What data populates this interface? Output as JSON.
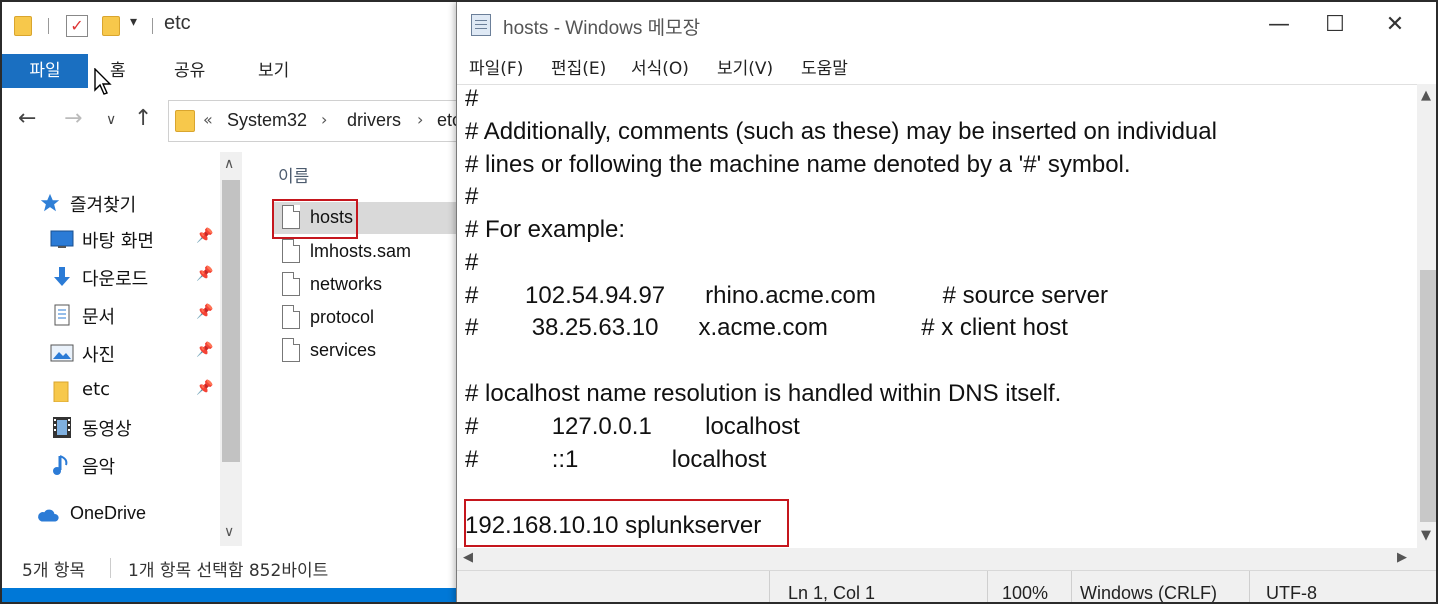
{
  "explorer": {
    "window_title": "etc",
    "ribbon_tabs": [
      "파일",
      "홈",
      "공유",
      "보기"
    ],
    "breadcrumb": [
      "System32",
      "drivers",
      "etc"
    ],
    "breadcrumb_prefix": "«",
    "nav_items": [
      {
        "label": "즐겨찾기",
        "icon": "star-icon"
      },
      {
        "label": "바탕 화면",
        "icon": "desktop-icon",
        "pinned": true
      },
      {
        "label": "다운로드",
        "icon": "download-icon",
        "pinned": true
      },
      {
        "label": "문서",
        "icon": "document-icon",
        "pinned": true
      },
      {
        "label": "사진",
        "icon": "picture-icon",
        "pinned": true
      },
      {
        "label": "etc",
        "icon": "folder-icon",
        "pinned": true
      },
      {
        "label": "동영상",
        "icon": "video-icon"
      },
      {
        "label": "음악",
        "icon": "music-icon"
      },
      {
        "label": "OneDrive",
        "icon": "cloud-icon"
      }
    ],
    "column_header": "이름",
    "files": [
      "hosts",
      "lmhosts.sam",
      "networks",
      "protocol",
      "services"
    ],
    "selected_file": "hosts",
    "status_count": "5개 항목",
    "status_selection": "1개 항목 선택함 852바이트"
  },
  "notepad": {
    "title": "hosts - Windows 메모장",
    "menu": [
      "파일(F)",
      "편집(E)",
      "서식(O)",
      "보기(V)",
      "도움말"
    ],
    "lines": [
      "#",
      "# Additionally, comments (such as these) may be inserted on individual",
      "# lines or following the machine name denoted by a '#' symbol.",
      "#",
      "# For example:",
      "#",
      "#       102.54.94.97      rhino.acme.com          # source server",
      "#        38.25.63.10      x.acme.com              # x client host",
      "",
      "# localhost name resolution is handled within DNS itself.",
      "#           127.0.0.1        localhost",
      "#           ::1              localhost",
      "",
      "192.168.10.10 splunkserver"
    ],
    "status": {
      "position": "Ln 1, Col 1",
      "zoom": "100%",
      "line_ending": "Windows (CRLF)",
      "encoding": "UTF-8"
    }
  },
  "colors": {
    "accent": "#1a6fc1",
    "highlight_box": "#c5161d",
    "taskbar_blue": "#0078d7"
  }
}
